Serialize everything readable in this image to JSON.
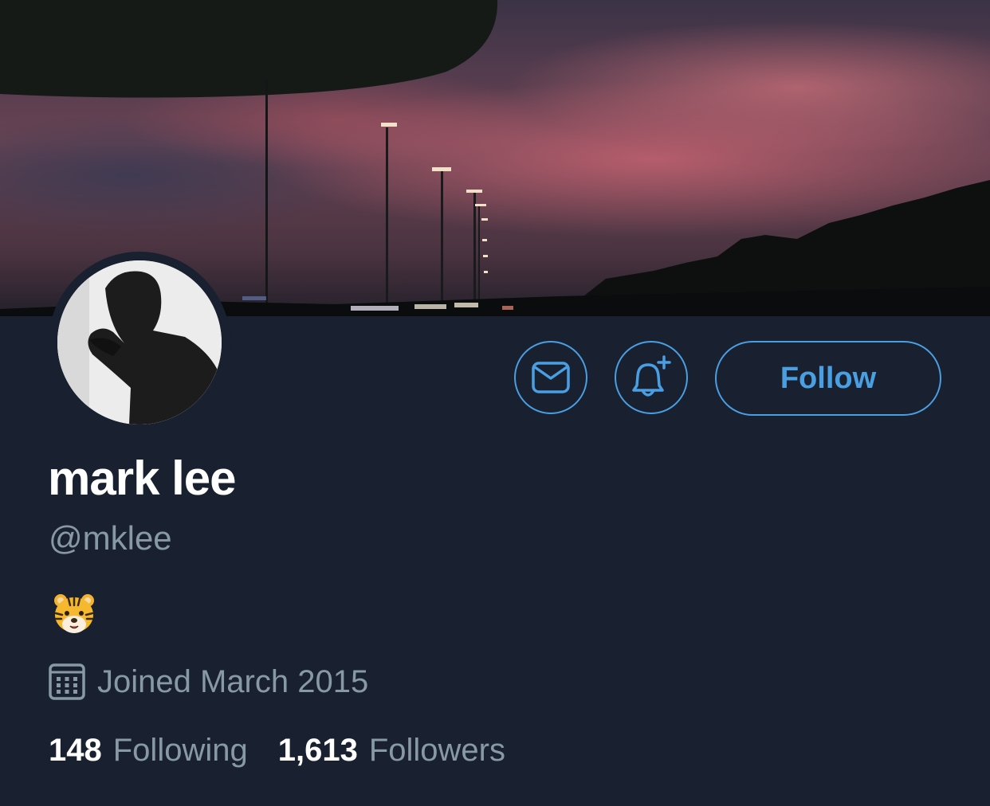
{
  "profile": {
    "display_name": "mark lee",
    "handle": "@mklee",
    "bio_emoji": "tiger-face",
    "joined": "Joined March 2015",
    "following_count": "148",
    "following_label": "Following",
    "followers_count": "1,613",
    "followers_label": "Followers"
  },
  "actions": {
    "message_icon": "envelope-icon",
    "notify_icon": "bell-plus-icon",
    "follow_label": "Follow"
  },
  "colors": {
    "background": "#192130",
    "accent": "#4a9fe3",
    "secondary_text": "#8899a6"
  }
}
